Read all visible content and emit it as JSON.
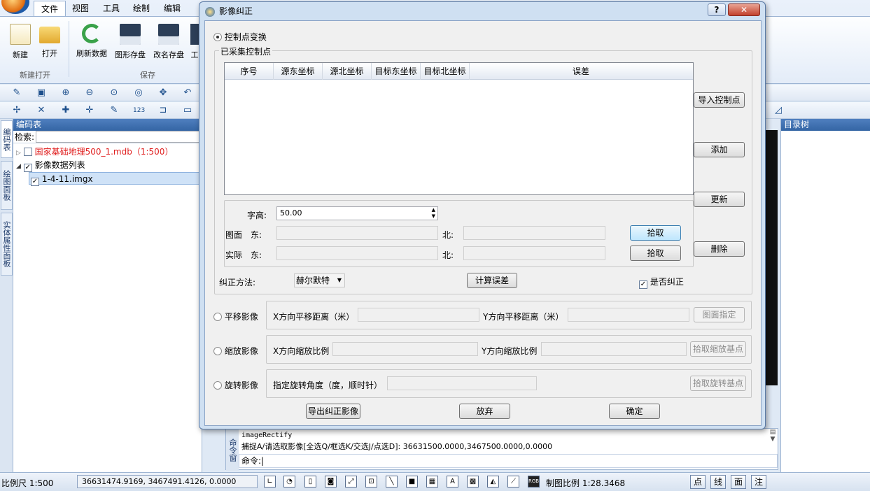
{
  "ribbon": {
    "tabs": [
      "文件",
      "视图",
      "工具",
      "绘制",
      "编辑"
    ],
    "buttons": {
      "new": "新建",
      "open": "打开",
      "refresh": "刷新数据",
      "save": "图形存盘",
      "save_as": "改名存盘",
      "more": "工"
    },
    "groups": {
      "new_open": "新建打开",
      "save": "保存"
    }
  },
  "left_panel": {
    "title": "编码表",
    "search_label": "检索:",
    "vertical_tabs": [
      "编码表",
      "绘图面板",
      "实体属性面板"
    ],
    "tree": [
      {
        "label": "国家基础地理500_1.mdb（1:500）",
        "checked": false,
        "color": "#e02020"
      },
      {
        "label": "影像数据列表",
        "checked": true,
        "color": "#000000"
      },
      {
        "label": "1-4-11.imgx",
        "checked": true,
        "color": "#000000"
      }
    ]
  },
  "right_panel": {
    "title": "目录树"
  },
  "command": {
    "label": "命令窗",
    "lines": [
      "imageRectify",
      "捕捉A/请选取影像[全选Q/框选K/交选J/点选D]:  36631500.0000,3467500.0000,0.0000"
    ],
    "prompt": "命令:|"
  },
  "status": {
    "scale": "比例尺 1:500",
    "coords": "36631474.9169, 3467491.4126, 0.0000",
    "map_scale": "制图比例 1:28.3468",
    "mode_buttons": [
      "点",
      "线",
      "面",
      "注"
    ]
  },
  "dialog": {
    "title": "影像纠正",
    "help": "?",
    "close": "✕",
    "mode_control": "控制点变换",
    "collected_group": "已采集控制点",
    "columns": [
      "序号",
      "源东坐标",
      "源北坐标",
      "目标东坐标",
      "目标北坐标",
      "误差"
    ],
    "side_buttons": {
      "import": "导入控制点",
      "add": "添加",
      "update": "更新",
      "delete": "删除"
    },
    "char_height_label": "字高:",
    "char_height_value": "50.00",
    "map_label": "图面",
    "actual_label": "实际",
    "east": "东:",
    "north": "北:",
    "pick": "拾取",
    "method_label": "纠正方法:",
    "method_value": "赫尔默特",
    "calc_error": "计算误差",
    "rectify_check": "是否纠正",
    "translate": {
      "radio": "平移影像",
      "x": "X方向平移距离（米）",
      "y": "Y方向平移距离（米）",
      "btn": "图面指定"
    },
    "scale": {
      "radio": "缩放影像",
      "x": "X方向缩放比例",
      "y": "Y方向缩放比例",
      "btn": "拾取缩放基点"
    },
    "rotate": {
      "radio": "旋转影像",
      "angle": "指定旋转角度（度，顺时针）",
      "btn": "拾取旋转基点"
    },
    "export": "导出纠正影像",
    "cancel": "放弃",
    "ok": "确定"
  }
}
